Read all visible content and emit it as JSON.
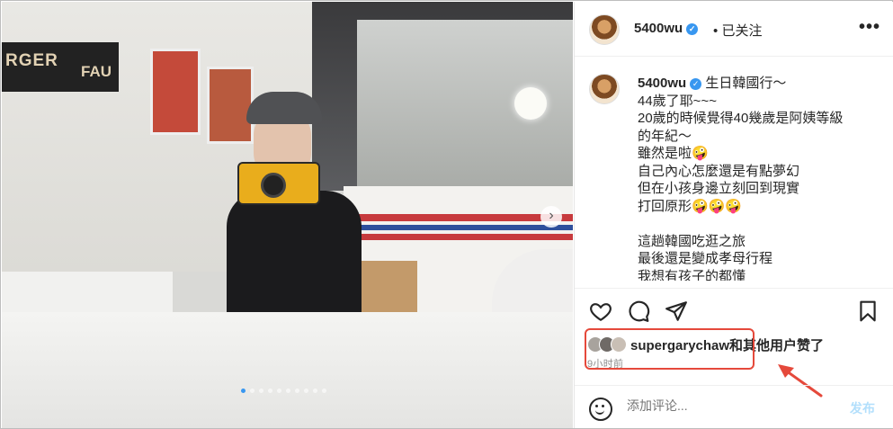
{
  "post": {
    "username": "5400wu",
    "separator": "•",
    "follow_status": "已关注",
    "more_label": "•••",
    "sign_text_1": "RGER",
    "sign_text_2": "FAU",
    "caption_lines": [
      "生日韓國行～",
      "44歲了耶~~~",
      "20歲的時候覺得40幾歲是阿姨等級",
      "的年紀～",
      "雖然是啦🤪",
      "自己內心怎麼還是有點夢幻",
      "但在小孩身邊立刻回到現實",
      "打回原形🤪🤪🤪",
      "",
      "這趟韓國吃逛之旅",
      "最後還是變成孝母行程",
      "我想有孩子的都懂"
    ],
    "likes": {
      "first_user": "supergarychaw",
      "rest": "和其他用户赞了"
    },
    "time": "9小时前",
    "comment": {
      "placeholder": "添加评论...",
      "post_label": "发布"
    },
    "carousel": {
      "count": 10,
      "active_index": 0
    }
  },
  "colors": {
    "accent": "#3897f0",
    "highlight": "#e5493b",
    "post_disabled": "#b2dffc"
  },
  "icons": [
    "verified-icon",
    "more-icon",
    "next-arrow-icon",
    "heart-icon",
    "comment-icon",
    "share-icon",
    "bookmark-icon",
    "emoji-icon",
    "annotation-arrow-icon"
  ]
}
